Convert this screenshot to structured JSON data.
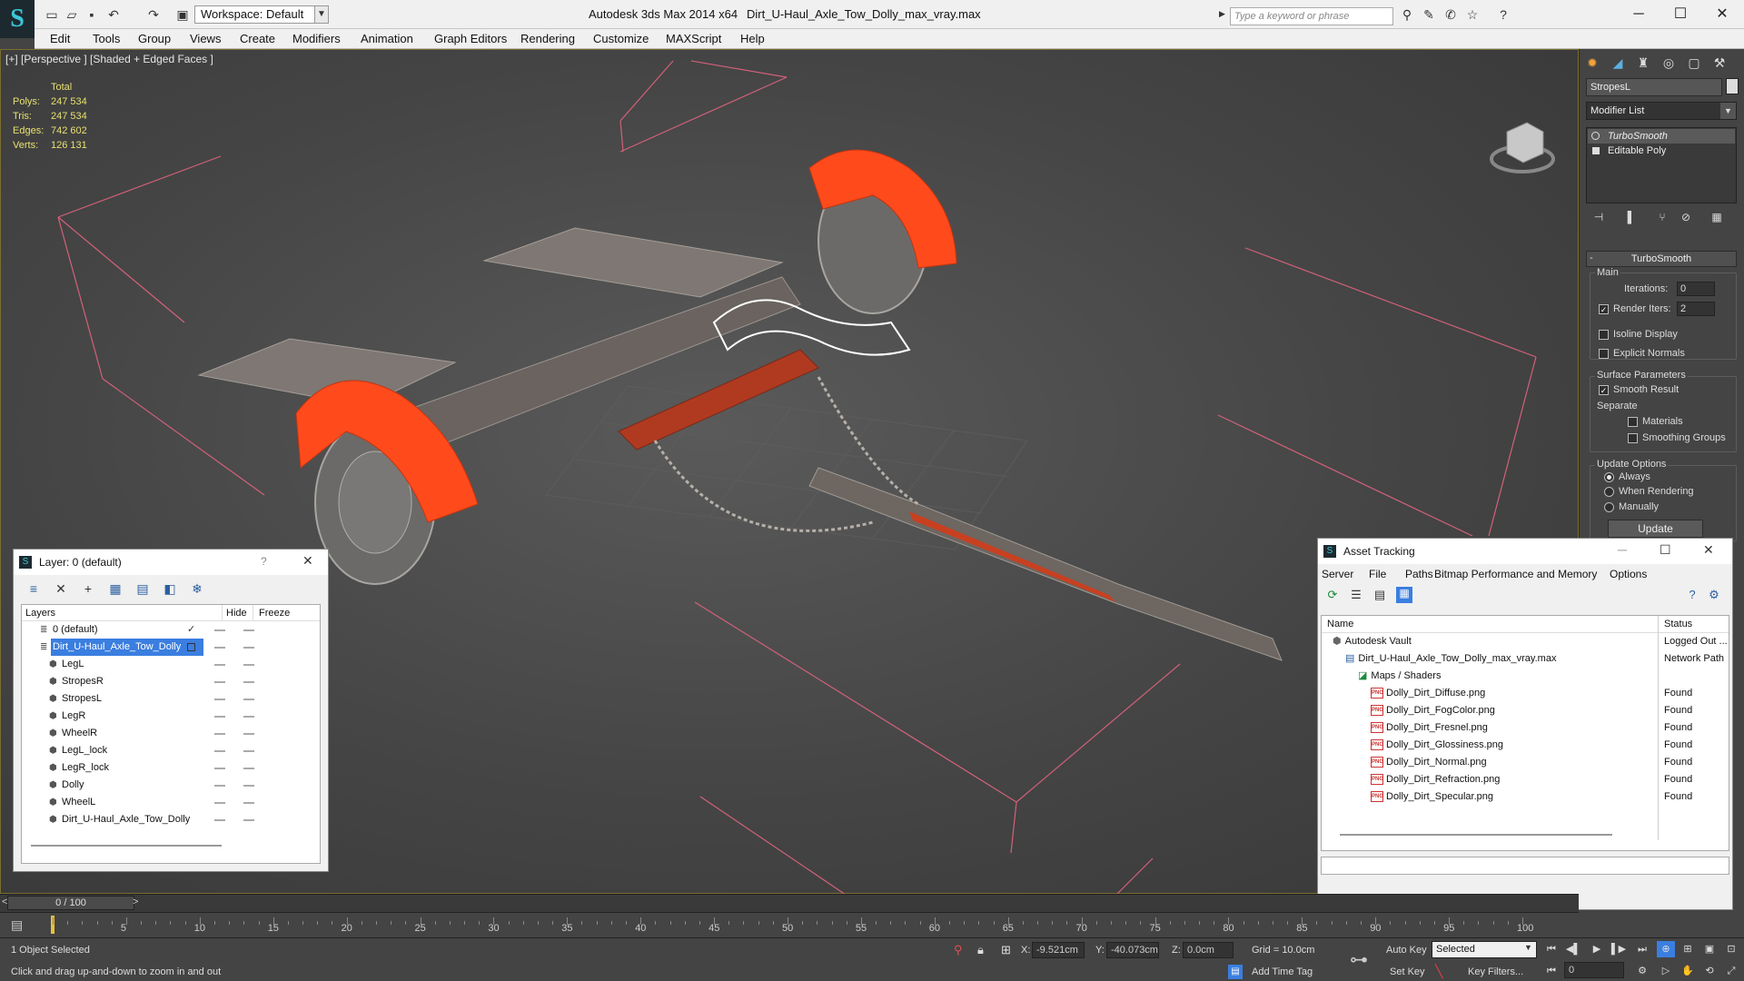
{
  "app": {
    "title": "Autodesk 3ds Max  2014 x64",
    "file": "Dirt_U-Haul_Axle_Tow_Dolly_max_vray.max",
    "workspace": "Workspace: Default",
    "search_placeholder": "Type a keyword or phrase"
  },
  "menu": [
    "Edit",
    "Tools",
    "Group",
    "Views",
    "Create",
    "Modifiers",
    "Animation",
    "Graph Editors",
    "Rendering",
    "Customize",
    "MAXScript",
    "Help"
  ],
  "viewport": {
    "label": "[+] [Perspective ] [Shaded + Edged Faces ]",
    "stats": {
      "header": "Total",
      "rows": [
        {
          "label": "Polys:",
          "value": "247 534"
        },
        {
          "label": "Tris:",
          "value": "247 534"
        },
        {
          "label": "Edges:",
          "value": "742 602"
        },
        {
          "label": "Verts:",
          "value": "126 131"
        }
      ]
    }
  },
  "command_panel": {
    "object_name": "StropesL",
    "modifier_list": "Modifier List",
    "stack": [
      "TurboSmooth",
      "Editable Poly"
    ],
    "rollout_title": "TurboSmooth",
    "main_group": "Main",
    "iterations_label": "Iterations:",
    "iterations_value": "0",
    "render_iters_label": "Render Iters:",
    "render_iters_value": "2",
    "isoline": "Isoline Display",
    "explicit_normals": "Explicit Normals",
    "surface_group": "Surface Parameters",
    "smooth_result": "Smooth Result",
    "separate": "Separate",
    "materials": "Materials",
    "smoothing_groups": "Smoothing Groups",
    "update_group": "Update Options",
    "always": "Always",
    "when_rendering": "When Rendering",
    "manually": "Manually",
    "update_button": "Update"
  },
  "layer_window": {
    "title": "Layer: 0 (default)",
    "help": "?",
    "columns": {
      "name": "Layers",
      "hide": "Hide",
      "freeze": "Freeze"
    },
    "rows": [
      {
        "name": "0 (default)",
        "level": 1,
        "selected": false
      },
      {
        "name": "Dirt_U-Haul_Axle_Tow_Dolly",
        "level": 1,
        "selected": true
      },
      {
        "name": "LegL",
        "level": 2,
        "selected": false
      },
      {
        "name": "StropesR",
        "level": 2,
        "selected": false
      },
      {
        "name": "StropesL",
        "level": 2,
        "selected": false
      },
      {
        "name": "LegR",
        "level": 2,
        "selected": false
      },
      {
        "name": "WheelR",
        "level": 2,
        "selected": false
      },
      {
        "name": "LegL_lock",
        "level": 2,
        "selected": false
      },
      {
        "name": "LegR_lock",
        "level": 2,
        "selected": false
      },
      {
        "name": "Dolly",
        "level": 2,
        "selected": false
      },
      {
        "name": "WheelL",
        "level": 2,
        "selected": false
      },
      {
        "name": "Dirt_U-Haul_Axle_Tow_Dolly",
        "level": 2,
        "selected": false
      }
    ]
  },
  "asset_window": {
    "title": "Asset Tracking",
    "menu": [
      "Server",
      "File",
      "Paths",
      "Bitmap Performance and Memory",
      "Options"
    ],
    "columns": {
      "name": "Name",
      "status": "Status"
    },
    "rows": [
      {
        "name": "Autodesk Vault",
        "status": "Logged Out ...",
        "level": 1,
        "icon": "vault"
      },
      {
        "name": "Dirt_U-Haul_Axle_Tow_Dolly_max_vray.max",
        "status": "Network Path",
        "level": 2,
        "icon": "max"
      },
      {
        "name": "Maps / Shaders",
        "status": "",
        "level": 3,
        "icon": "folder"
      },
      {
        "name": "Dolly_Dirt_Diffuse.png",
        "status": "Found",
        "level": 4,
        "icon": "png"
      },
      {
        "name": "Dolly_Dirt_FogColor.png",
        "status": "Found",
        "level": 4,
        "icon": "png"
      },
      {
        "name": "Dolly_Dirt_Fresnel.png",
        "status": "Found",
        "level": 4,
        "icon": "png"
      },
      {
        "name": "Dolly_Dirt_Glossiness.png",
        "status": "Found",
        "level": 4,
        "icon": "png"
      },
      {
        "name": "Dolly_Dirt_Normal.png",
        "status": "Found",
        "level": 4,
        "icon": "png"
      },
      {
        "name": "Dolly_Dirt_Refraction.png",
        "status": "Found",
        "level": 4,
        "icon": "png"
      },
      {
        "name": "Dolly_Dirt_Specular.png",
        "status": "Found",
        "level": 4,
        "icon": "png"
      }
    ]
  },
  "timeline": {
    "frame": "0 / 100",
    "ticks": [
      "5",
      "10",
      "15",
      "20",
      "25",
      "30",
      "35",
      "40",
      "45",
      "50",
      "55",
      "60",
      "65",
      "70",
      "75",
      "80",
      "85",
      "90",
      "95",
      "100"
    ]
  },
  "status": {
    "selection": "1 Object Selected",
    "prompt": "Click and drag up-and-down to zoom in and out",
    "x_label": "X:",
    "x": "-9.521cm",
    "y_label": "Y:",
    "y": "-40.073cm",
    "z_label": "Z:",
    "z": "0.0cm",
    "grid": "Grid = 10.0cm",
    "add_time_tag": "Add Time Tag",
    "auto_key": "Auto Key",
    "set_key": "Set Key",
    "selected_dropdown": "Selected",
    "key_filters": "Key Filters...",
    "frame_field": "0"
  },
  "colors": {
    "accent_orange": "#ff4a1c",
    "selection_blue": "#3a7ee0",
    "stats_yellow": "#e8e070"
  }
}
